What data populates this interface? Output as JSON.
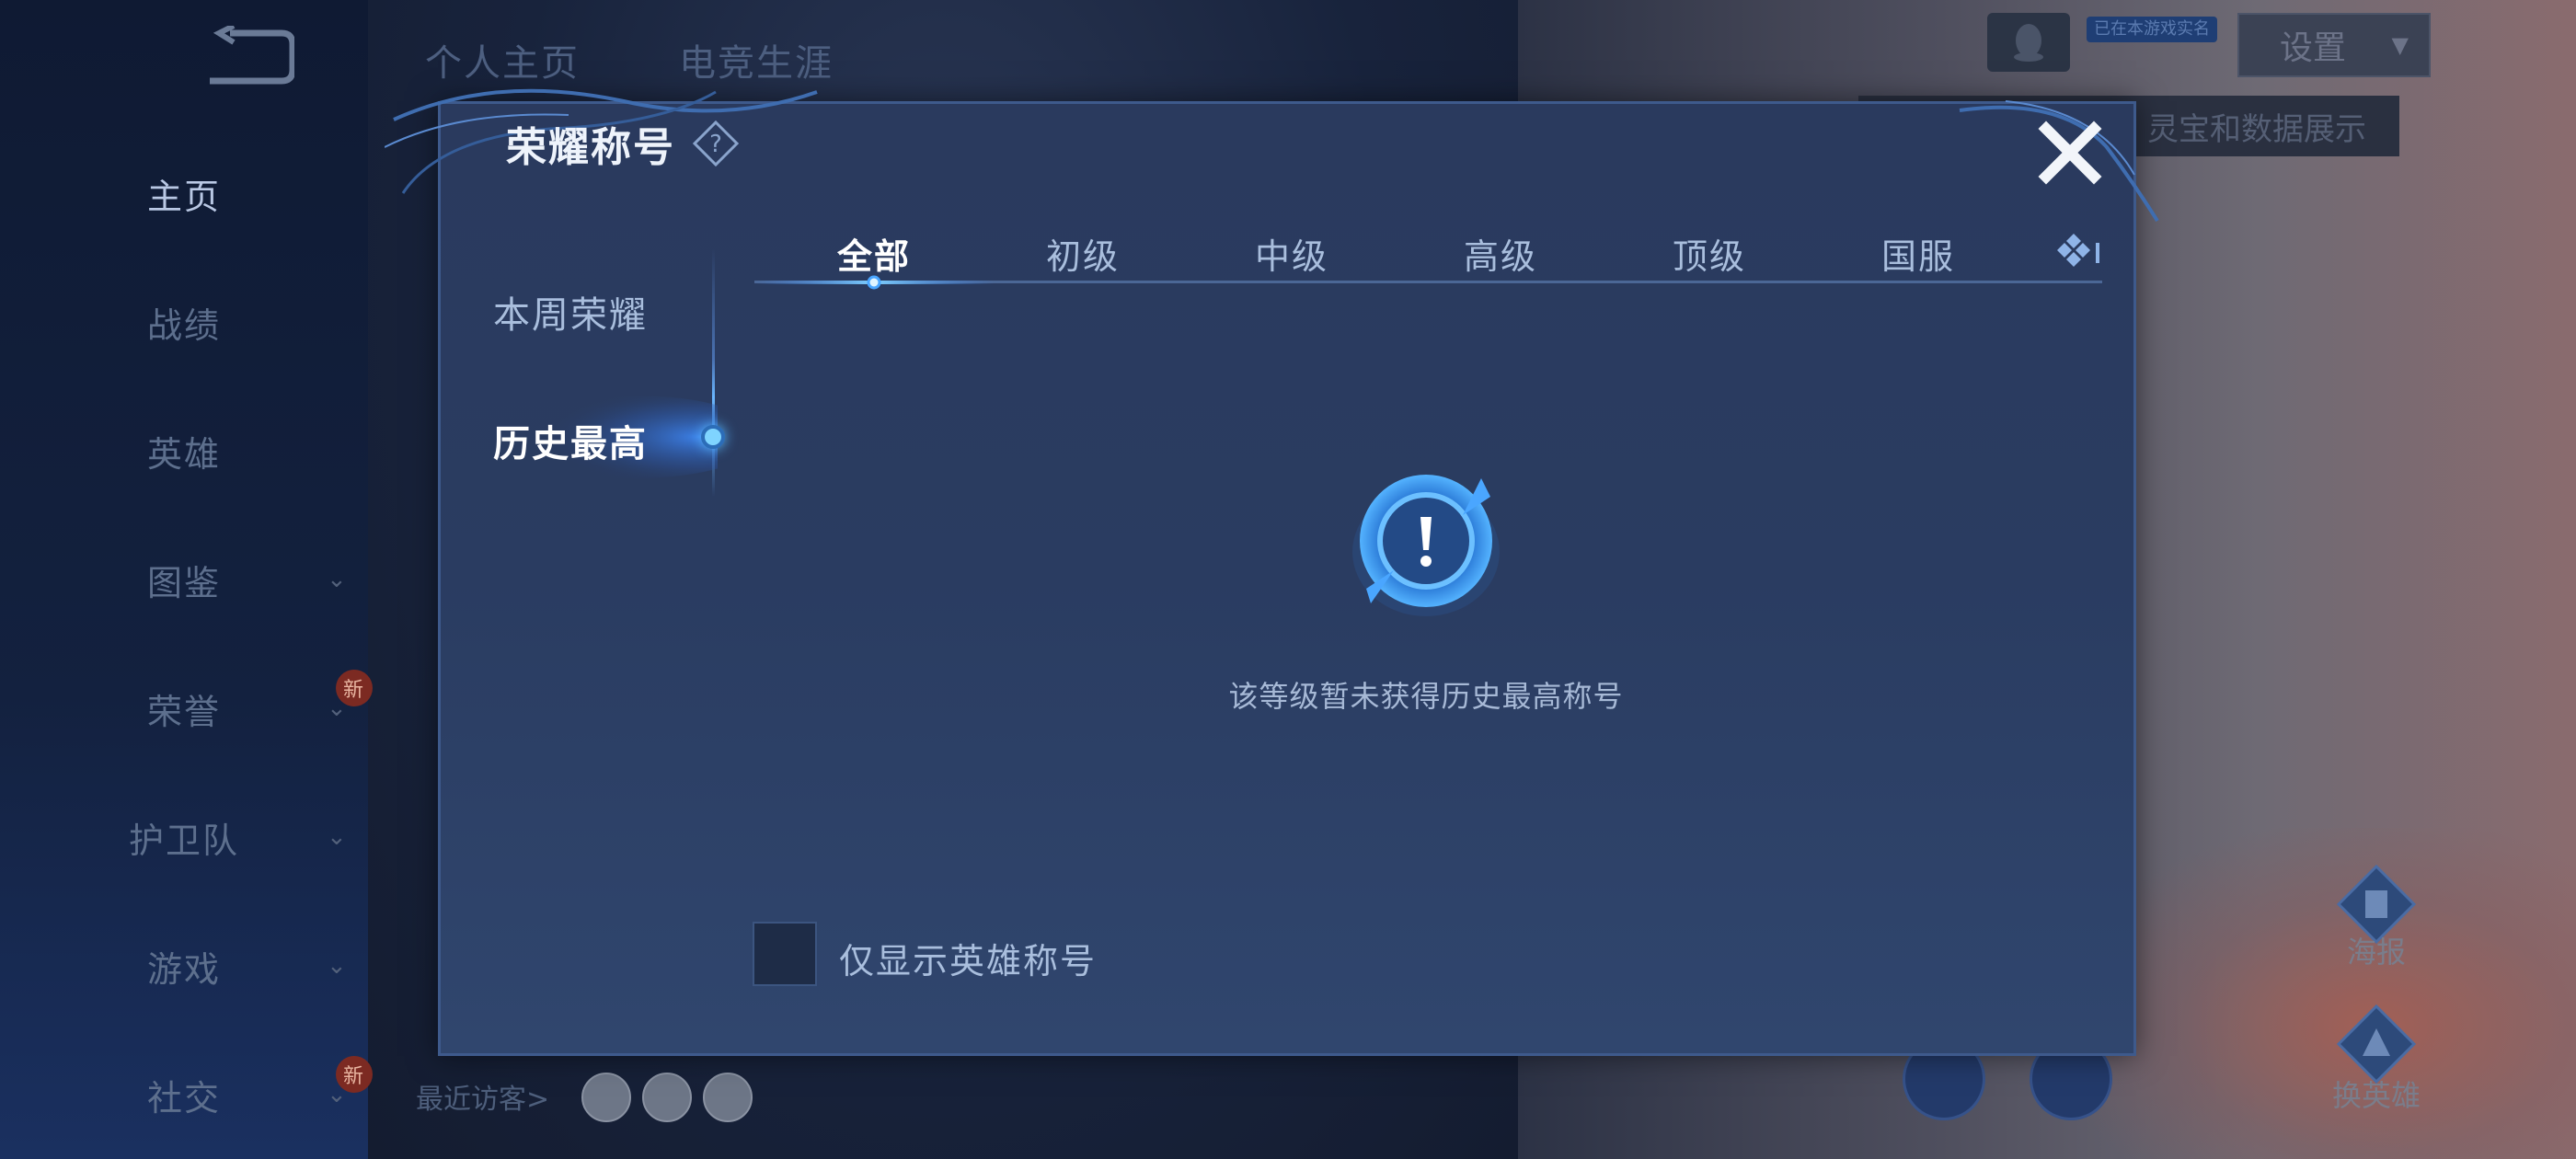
{
  "background": {
    "left_nav": [
      {
        "label": "主页",
        "active": true,
        "chevron": false,
        "badge": ""
      },
      {
        "label": "战绩",
        "active": false,
        "chevron": false,
        "badge": ""
      },
      {
        "label": "英雄",
        "active": false,
        "chevron": false,
        "badge": ""
      },
      {
        "label": "图鉴",
        "active": false,
        "chevron": true,
        "badge": ""
      },
      {
        "label": "荣誉",
        "active": false,
        "chevron": true,
        "badge": "新"
      },
      {
        "label": "护卫队",
        "active": false,
        "chevron": true,
        "badge": ""
      },
      {
        "label": "游戏",
        "active": false,
        "chevron": true,
        "badge": ""
      },
      {
        "label": "社交",
        "active": false,
        "chevron": true,
        "badge": "新"
      }
    ],
    "top_tabs": [
      "个人主页",
      "电竞生涯"
    ],
    "real_name_badge": "已在本游戏实名",
    "settings_label": "设置",
    "tooltip_text": "灵宝和数据展示",
    "recent_visitors_label": "最近访客>",
    "side_buttons": {
      "poster": "海报",
      "switch_hero": "换英雄"
    }
  },
  "dialog": {
    "title": "荣耀称号",
    "vertical_tabs": {
      "weekly": "本周荣耀",
      "history": "历史最高"
    },
    "level_tabs": [
      "全部",
      "初级",
      "中级",
      "高级",
      "顶级",
      "国服"
    ],
    "active_level_tab": "全部",
    "empty_message": "该等级暂未获得历史最高称号",
    "checkbox": {
      "label": "仅显示英雄称号",
      "checked": false
    }
  },
  "colors": {
    "dialog_bg": "#2a3c61",
    "accent": "#59b8ff",
    "text_primary": "#ffffff",
    "text_secondary": "#a9bedd"
  }
}
